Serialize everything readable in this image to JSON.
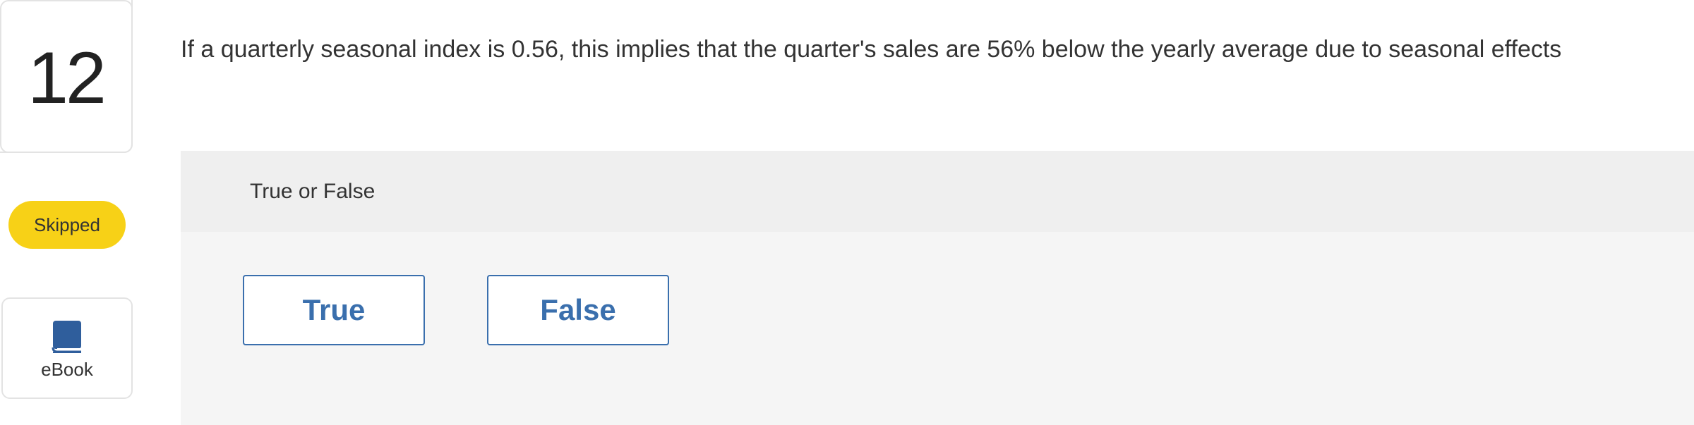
{
  "question": {
    "number": "12",
    "status": "Skipped",
    "text": "If a quarterly seasonal index is 0.56, this implies that the quarter's sales are 56% below the yearly average due to seasonal effects"
  },
  "sidebar": {
    "ebook_label": "eBook",
    "ebook_icon": "book-icon"
  },
  "answer": {
    "type_label": "True or False",
    "choices": [
      {
        "label": "True"
      },
      {
        "label": "False"
      }
    ]
  },
  "colors": {
    "accent": "#3a6fad",
    "status_badge": "#f7d117",
    "ebook_icon": "#2f5e9c",
    "panel_bg": "#f5f5f5",
    "panel_header_bg": "#efefef"
  }
}
